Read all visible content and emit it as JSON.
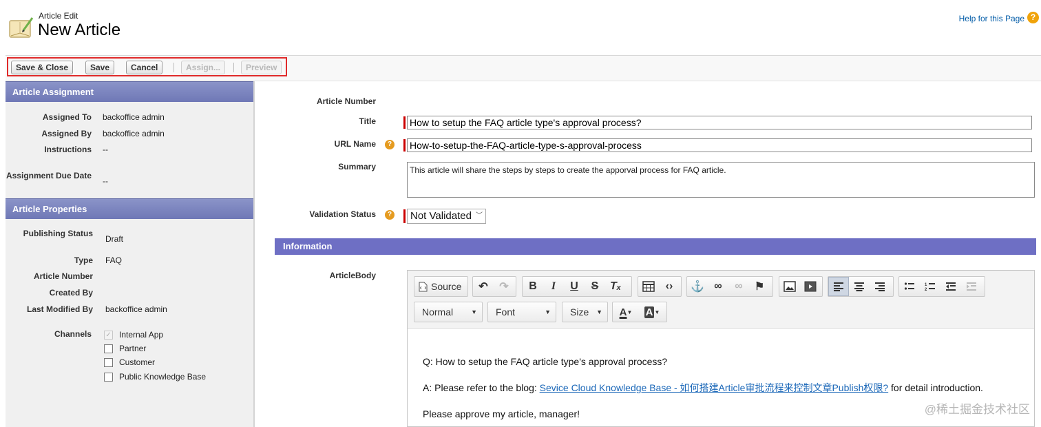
{
  "header": {
    "subtitle": "Article Edit",
    "title": "New Article",
    "help_link": "Help for this Page",
    "help_icon": "?"
  },
  "toolbar": {
    "buttons": [
      "Save & Close",
      "Save",
      "Cancel",
      "Assign...",
      "Preview"
    ]
  },
  "sidebar": {
    "assignment": {
      "header": "Article Assignment",
      "assigned_to_label": "Assigned To",
      "assigned_to": "backoffice admin",
      "assigned_by_label": "Assigned By",
      "assigned_by": "backoffice admin",
      "instructions_label": "Instructions",
      "instructions": "--",
      "due_label": "Assignment Due Date",
      "due": "--"
    },
    "properties": {
      "header": "Article Properties",
      "publishing_status_label": "Publishing Status",
      "publishing_status": "Draft",
      "type_label": "Type",
      "type": "FAQ",
      "article_number_label": "Article Number",
      "created_by_label": "Created By",
      "last_modified_label": "Last Modified By",
      "last_modified": "backoffice admin",
      "channels_label": "Channels",
      "channels": [
        {
          "label": "Internal App",
          "checked": true
        },
        {
          "label": "Partner",
          "checked": false
        },
        {
          "label": "Customer",
          "checked": false
        },
        {
          "label": "Public Knowledge Base",
          "checked": false
        }
      ]
    }
  },
  "form": {
    "article_number_label": "Article Number",
    "title_label": "Title",
    "title_value": "How to setup the FAQ article type's approval process?",
    "url_name_label": "URL Name",
    "url_name_value": "How-to-setup-the-FAQ-article-type-s-approval-process",
    "summary_label": "Summary",
    "summary_value": "This article will share the steps by steps to create the apporval process for FAQ article.",
    "validation_label": "Validation Status",
    "validation_value": "Not Validated",
    "info_header": "Information",
    "body_label": "ArticleBody"
  },
  "editor": {
    "source_label": "Source",
    "format_dropdown": "Normal",
    "font_dropdown": "Font",
    "size_dropdown": "Size",
    "line1": "Q: How to setup the FAQ article type's approval process?",
    "line2_prefix": "A: Please refer to the blog: ",
    "line2_link": "Sevice Cloud Knowledge Base - 如何搭建Article审批流程来控制文章Publish权限?",
    "line2_suffix": " for detail introduction.",
    "line3": "Please approve my article, manager!"
  },
  "watermark": "@稀土掘金技术社区",
  "colors": {
    "section_header": "#6f78b6",
    "info_bar": "#6e6fc4",
    "highlight_box": "#e02a2a",
    "required": "#cc0000",
    "link": "#1a67b8"
  }
}
